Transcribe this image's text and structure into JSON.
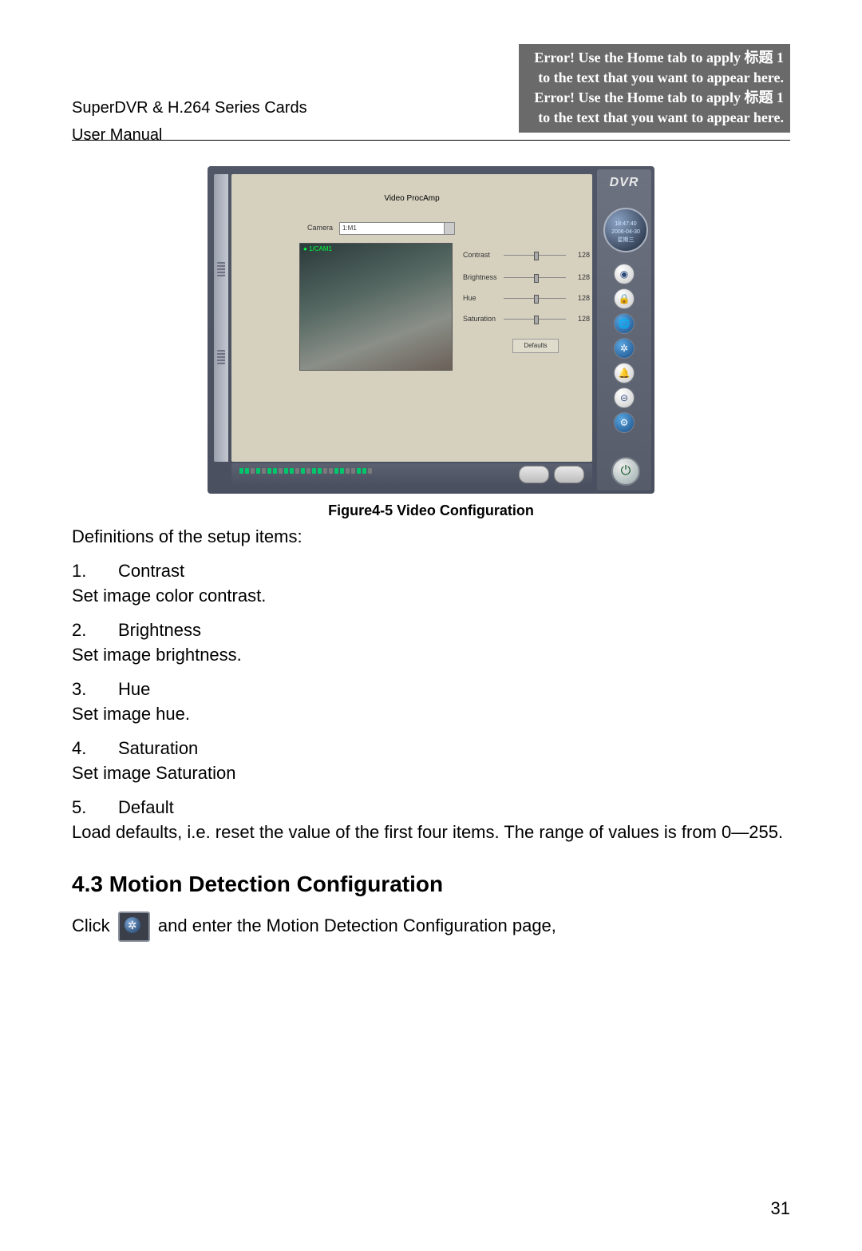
{
  "header": {
    "left_line1": "SuperDVR & H.264 Series Cards",
    "left_line2": "User Manual",
    "banner": "Error! Use the Home tab to apply 标题 1 to the text that you want to appear here. Error! Use the Home tab to apply 标题 1 to the text that you want to appear here."
  },
  "figure": {
    "caption": "Figure4-5  Video Configuration",
    "window_title": "Video ProcAmp",
    "camera_label": "Camera",
    "camera_value": "1:M1",
    "preview_label": "● 1/CAM1",
    "sliders": [
      {
        "label": "Contrast",
        "value": "128"
      },
      {
        "label": "Brightness",
        "value": "128"
      },
      {
        "label": "Hue",
        "value": "128"
      },
      {
        "label": "Saturation",
        "value": "128"
      }
    ],
    "defaults_btn": "Defaults",
    "logo": "DVR",
    "dial_line1": "18:47:40",
    "dial_line2": "2006-04-30",
    "dial_line3": "星期三"
  },
  "definitions": {
    "intro": "Definitions of the setup items:",
    "items": [
      {
        "num": "1.",
        "title": "Contrast",
        "desc": "Set image color contrast."
      },
      {
        "num": "2.",
        "title": "Brightness",
        "desc": "Set image brightness."
      },
      {
        "num": "3.",
        "title": "Hue",
        "desc": "Set image hue."
      },
      {
        "num": "4.",
        "title": "Saturation",
        "desc": "Set image Saturation"
      },
      {
        "num": "5.",
        "title": "Default",
        "desc": "Load defaults, i.e. reset the value of the first four items. The range of values is from 0—255."
      }
    ]
  },
  "section": {
    "heading": "4.3 Motion Detection Configuration",
    "click_pre": "Click ",
    "click_post": " and enter the Motion Detection Configuration page,"
  },
  "page_number": "31"
}
